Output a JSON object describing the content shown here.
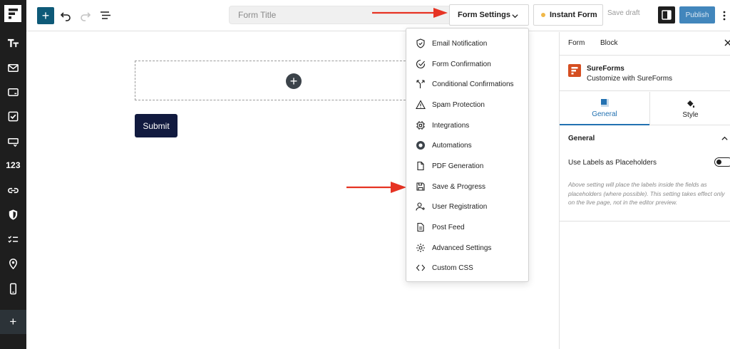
{
  "app": {
    "colors": {
      "brand": "#0e5a78",
      "accent": "#2271b1",
      "submit": "#111a3f",
      "arrow": "#e63323",
      "status_dot": "#f0b849"
    }
  },
  "leftbar": {
    "items": [
      {
        "icon": "typography-icon"
      },
      {
        "icon": "mail-icon"
      },
      {
        "icon": "input-field-icon"
      },
      {
        "icon": "checkbox-icon"
      },
      {
        "icon": "dropdown-icon"
      },
      {
        "icon": "number-icon",
        "text": "123"
      },
      {
        "icon": "link-icon"
      },
      {
        "icon": "shield-icon"
      },
      {
        "icon": "checklist-icon"
      },
      {
        "icon": "location-pin-icon"
      },
      {
        "icon": "phone-icon"
      },
      {
        "icon": "plus-icon",
        "text": "+"
      }
    ]
  },
  "toolbar": {
    "add_label": "+",
    "title_placeholder": "Form Title",
    "form_settings_label": "Form Settings",
    "instant_form_label": "Instant Form",
    "save_draft_label": "Save draft",
    "publish_label": "Publish"
  },
  "canvas": {
    "add_block_label": "+",
    "submit_label": "Submit"
  },
  "form_settings_menu": {
    "items": [
      {
        "label": "Email Notification",
        "icon": "shield-check-icon"
      },
      {
        "label": "Form Confirmation",
        "icon": "check-circle-icon"
      },
      {
        "label": "Conditional Confirmations",
        "icon": "branch-icon"
      },
      {
        "label": "Spam Protection",
        "icon": "warning-icon"
      },
      {
        "label": "Integrations",
        "icon": "chip-icon"
      },
      {
        "label": "Automations",
        "icon": "automation-icon"
      },
      {
        "label": "PDF Generation",
        "icon": "document-icon"
      },
      {
        "label": "Save & Progress",
        "icon": "floppy-icon"
      },
      {
        "label": "User Registration",
        "icon": "user-plus-icon"
      },
      {
        "label": "Post Feed",
        "icon": "post-icon"
      },
      {
        "label": "Advanced Settings",
        "icon": "gear-icon"
      },
      {
        "label": "Custom CSS",
        "icon": "code-icon"
      }
    ]
  },
  "sidebar_panel": {
    "tabs": [
      "Form",
      "Block"
    ],
    "plugin_name": "SureForms",
    "plugin_desc": "Customize with SureForms",
    "subtabs": [
      "General",
      "Style"
    ],
    "section_title": "General",
    "option_label": "Use Labels as Placeholders",
    "option_enabled": false,
    "help_text": "Above setting will place the labels inside the fields as placeholders (where possible). This setting takes effect only on the live page, not in the editor preview."
  }
}
